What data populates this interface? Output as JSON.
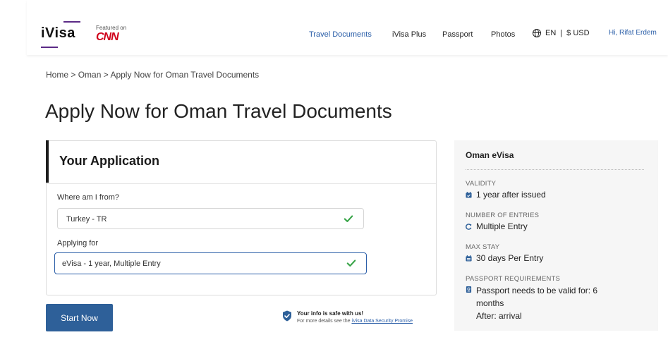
{
  "header": {
    "logo": "iVisa",
    "featured_on": "Featured on",
    "cnn": "CNN",
    "nav": [
      "Travel Documents",
      "iVisa Plus",
      "Passport",
      "Photos"
    ],
    "language": "EN",
    "currency": "$ USD",
    "separator": "|",
    "user": "Hi, Rifat Erdem"
  },
  "breadcrumb": {
    "home": "Home",
    "country": "Oman",
    "current": "Apply Now for Oman Travel Documents",
    "sep": ">"
  },
  "page_title": "Apply Now for Oman Travel Documents",
  "application": {
    "title": "Your Application",
    "from_label": "Where am I from?",
    "from_value": "Turkey - TR",
    "applying_label": "Applying for",
    "applying_value": "eVisa - 1 year, Multiple Entry",
    "start_button": "Start Now",
    "safe_title": "Your info is safe with us!",
    "safe_sub": "For more details see the",
    "safe_link": "iVisa Data Security Promise"
  },
  "summary": {
    "title": "Oman eVisa",
    "validity_label": "VALIDITY",
    "validity_value": "1 year after issued",
    "entries_label": "NUMBER OF ENTRIES",
    "entries_value": "Multiple Entry",
    "stay_label": "MAX STAY",
    "stay_value": "30 days Per Entry",
    "passport_label": "PASSPORT REQUIREMENTS",
    "passport_value": "Passport needs to be valid for: 6 months",
    "passport_after": "After: arrival"
  },
  "colors": {
    "accent_blue": "#2e6099",
    "link_blue": "#2a5ea8",
    "check_green": "#3aa54a",
    "brand_purple": "#5b2a86",
    "cnn_red": "#d0021b"
  },
  "icons": {
    "globe": "globe-icon",
    "check": "check-icon",
    "shield": "shield-check-icon",
    "calendar": "calendar-icon",
    "refresh": "refresh-icon",
    "passport": "passport-icon"
  }
}
